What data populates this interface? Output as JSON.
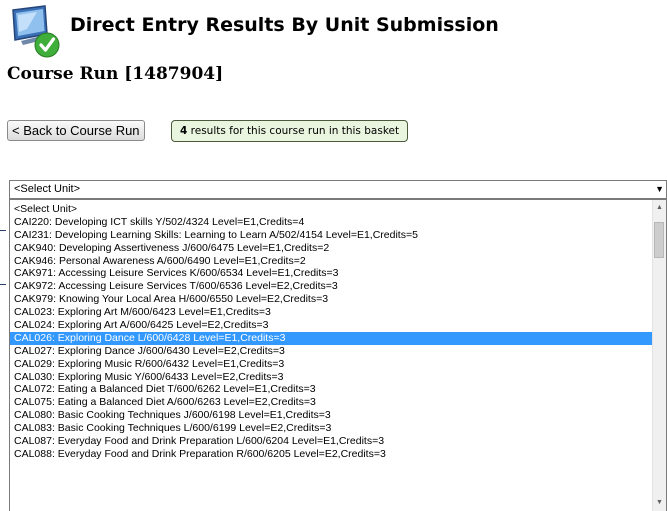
{
  "header": {
    "title": "Direct Entry Results By Unit Submission",
    "course_run": "Course Run [1487904]"
  },
  "toolbar": {
    "back_label": "< Back to Course Run",
    "results_count": "4",
    "results_text": " results for this course run in this basket"
  },
  "unit_select": {
    "selected_label": "<Select Unit>",
    "options": [
      "<Select Unit>",
      "CAI220: Developing ICT skills Y/502/4324 Level=E1,Credits=4",
      "CAI231: Developing Learning Skills: Learning to Learn A/502/4154 Level=E1,Credits=5",
      "CAK940: Developing Assertiveness J/600/6475 Level=E1,Credits=2",
      "CAK946: Personal Awareness A/600/6490 Level=E1,Credits=2",
      "CAK971: Accessing Leisure Services K/600/6534 Level=E1,Credits=3",
      "CAK972: Accessing Leisure Services T/600/6536 Level=E2,Credits=3",
      "CAK979: Knowing Your Local Area H/600/6550 Level=E2,Credits=3",
      "CAL023: Exploring Art M/600/6423 Level=E1,Credits=3",
      "CAL024: Exploring Art A/600/6425 Level=E2,Credits=3",
      "CAL026: Exploring Dance L/600/6428 Level=E1,Credits=3",
      "CAL027: Exploring Dance J/600/6430 Level=E2,Credits=3",
      "CAL029: Exploring Music R/600/6432 Level=E1,Credits=3",
      "CAL030: Exploring Music Y/600/6433 Level=E2,Credits=3",
      "CAL072: Eating a Balanced Diet T/600/6262 Level=E1,Credits=3",
      "CAL075: Eating a Balanced Diet A/600/6263 Level=E2,Credits=3",
      "CAL080: Basic Cooking Techniques J/600/6198 Level=E1,Credits=3",
      "CAL083: Basic Cooking Techniques L/600/6199 Level=E2,Credits=3",
      "CAL087: Everyday Food and Drink Preparation L/600/6204 Level=E1,Credits=3",
      "CAL088: Everyday Food and Drink Preparation R/600/6205 Level=E2,Credits=3"
    ],
    "highlighted_option": "CAL026: Exploring Dance L/600/6428 Level=E1,Credits=3"
  },
  "colors": {
    "highlight": "#3399ff",
    "badge_background": "#e9f5df"
  },
  "icons": {
    "header": "monitor-checkmark-icon"
  }
}
